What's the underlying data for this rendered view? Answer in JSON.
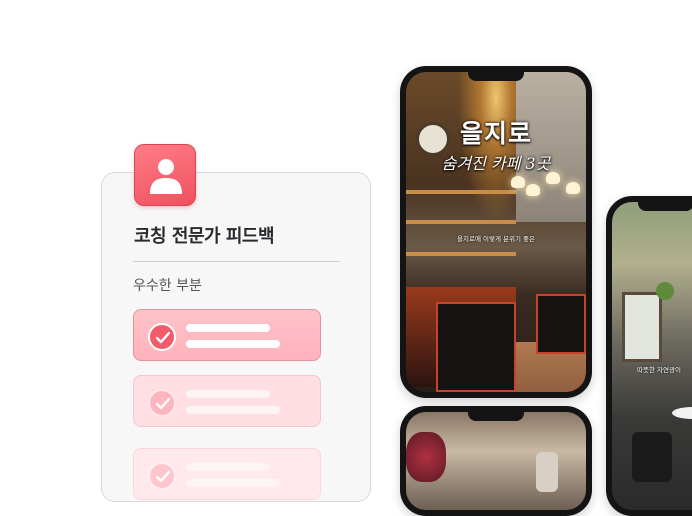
{
  "feedback_card": {
    "title": "코칭 전문가 피드백",
    "section_label": "우수한 부분",
    "items": [
      {
        "state": "highlighted"
      },
      {
        "state": "faded"
      },
      {
        "state": "faded-more"
      }
    ]
  },
  "phones": [
    {
      "title": "을지로",
      "subtitle": "숨겨진 카페 3곳",
      "caption": "을지로에 이렇게 분위기 좋은"
    },
    {
      "caption": ""
    },
    {
      "caption": "따뜻한 자연광이"
    }
  ],
  "colors": {
    "accent": "#f15b6a",
    "accent_light": "#ffc3ca",
    "card_bg": "#f7f7f8"
  },
  "icons": {
    "avatar": "user-icon",
    "check": "check-icon"
  }
}
